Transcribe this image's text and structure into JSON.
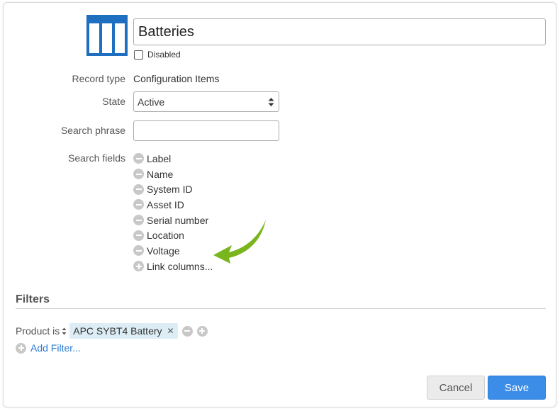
{
  "header": {
    "icon": "table-icon",
    "title_value": "Batteries",
    "disabled_label": "Disabled",
    "disabled_checked": false
  },
  "form": {
    "record_type": {
      "label": "Record type",
      "value": "Configuration Items"
    },
    "state": {
      "label": "State",
      "value": "Active"
    },
    "search_phrase": {
      "label": "Search phrase",
      "value": ""
    },
    "search_fields": {
      "label": "Search fields",
      "items": [
        "Label",
        "Name",
        "System ID",
        "Asset ID",
        "Serial number",
        "Location",
        "Voltage"
      ],
      "link_columns": "Link columns..."
    }
  },
  "filters": {
    "title": "Filters",
    "rows": [
      {
        "field": "Product is",
        "tag": "APC SYBT4 Battery"
      }
    ],
    "add_filter": "Add Filter..."
  },
  "footer": {
    "cancel_label": "Cancel",
    "save_label": "Save"
  },
  "colors": {
    "brand_blue": "#1f6fc0",
    "link": "#2b7bd6",
    "save_button": "#3b8de8",
    "tag_bg": "#ddedf5",
    "arrow_green": "#7ab51d"
  }
}
